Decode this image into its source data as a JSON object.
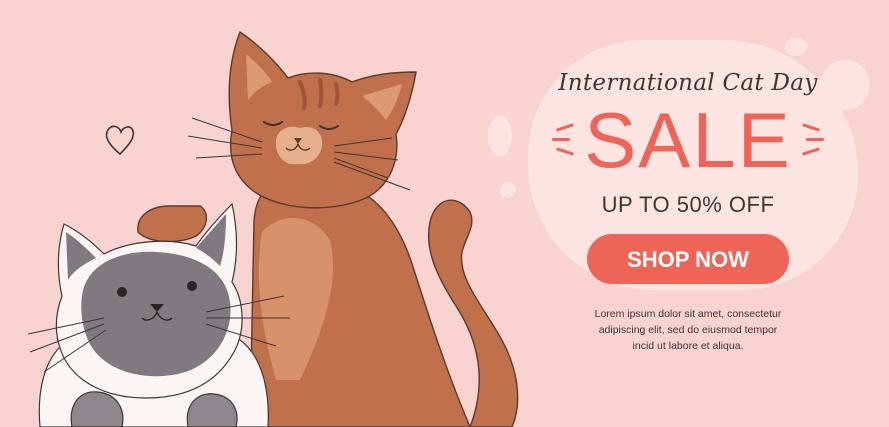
{
  "banner": {
    "eyebrow": "International Cat Day",
    "headline": "SALE",
    "subhead": "UP TO 50% OFF",
    "cta_label": "SHOP NOW",
    "body_lines": [
      "Lorem ipsum dolor sit amet, consectetur",
      "adipiscing elit, sed do eiusmod tempor",
      "incid ut labore et aliqua."
    ]
  },
  "colors": {
    "background": "#f9d3d0",
    "accent": "#ee6557",
    "text": "#3f3437",
    "ginger_cat": "#c0704a",
    "siamese_cat": "#7f7a7f"
  },
  "icons": [
    "heart-icon"
  ]
}
